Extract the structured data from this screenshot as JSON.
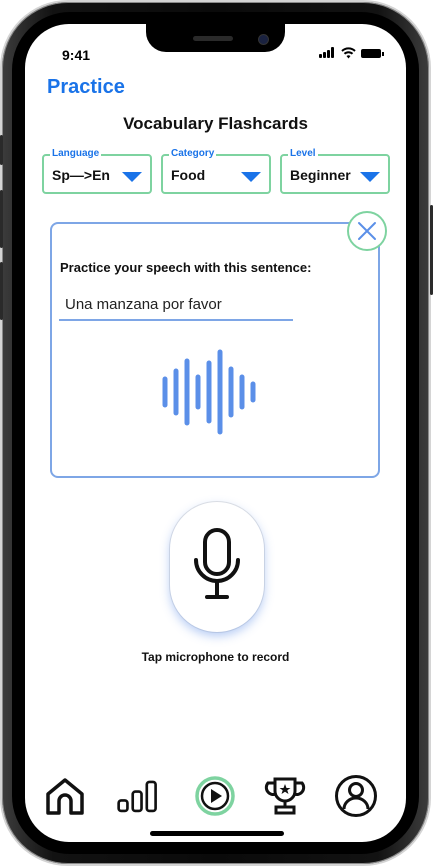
{
  "status_bar": {
    "time": "9:41"
  },
  "header": {
    "title": "Practice"
  },
  "section": {
    "title": "Vocabulary Flashcards"
  },
  "filters": {
    "language": {
      "label": "Language",
      "value": "Sp—>En"
    },
    "category": {
      "label": "Category",
      "value": "Food"
    },
    "level": {
      "label": "Level",
      "value": "Beginner"
    }
  },
  "card": {
    "prompt": "Practice your speech with this sentence:",
    "sentence": "Una manzana por favor"
  },
  "mic": {
    "caption": "Tap microphone to record"
  },
  "nav": {
    "items": [
      {
        "icon": "home-icon"
      },
      {
        "icon": "stats-icon"
      },
      {
        "icon": "play-icon",
        "active": true
      },
      {
        "icon": "trophy-icon"
      },
      {
        "icon": "profile-icon"
      }
    ]
  },
  "colors": {
    "accent_blue": "#1a73e8",
    "accent_green": "#7ed3a0",
    "card_border": "#7ea6e6",
    "wave": "#5b8fe8"
  }
}
